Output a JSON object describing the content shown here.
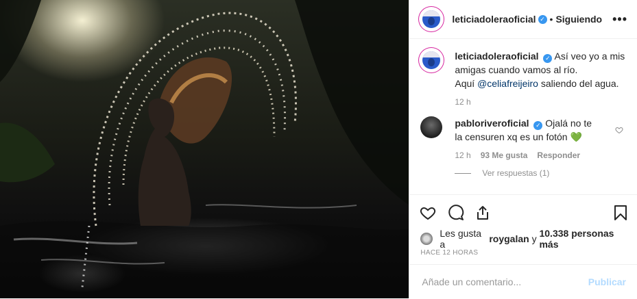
{
  "header": {
    "username": "leticiadoleraoficial",
    "separator": "•",
    "follow_label": "Siguiendo",
    "more": "•••"
  },
  "caption": {
    "username": "leticiadoleraoficial",
    "text_1": "Así veo yo a mis amigas cuando vamos al río.",
    "text_2": "Aquí",
    "mention": "@celiafreijeiro",
    "text_3": "saliendo del agua.",
    "time": "12 h"
  },
  "comment": {
    "username": "pabloriveroficial",
    "text": "Ojalá no te la censuren xq es un fotón",
    "emoji": "💚",
    "time": "12 h",
    "likes": "93 Me gusta",
    "reply_label": "Responder",
    "view_replies": "Ver respuestas (1)"
  },
  "likes": {
    "prefix": "Les gusta a",
    "user": "roygalan",
    "middle": "y",
    "count": "10.338 personas más"
  },
  "timestamp": "HACE 12 HORAS",
  "add_comment": {
    "placeholder": "Añade un comentario...",
    "publish_label": "Publicar"
  },
  "colors": {
    "verified": "#3897f0",
    "mention": "#003569",
    "publish_disabled": "#b3dbff",
    "emoji_heart": "#78c257"
  },
  "icons": [
    "more-icon",
    "verified-icon",
    "heart-icon",
    "comment-icon",
    "share-icon",
    "bookmark-icon"
  ]
}
